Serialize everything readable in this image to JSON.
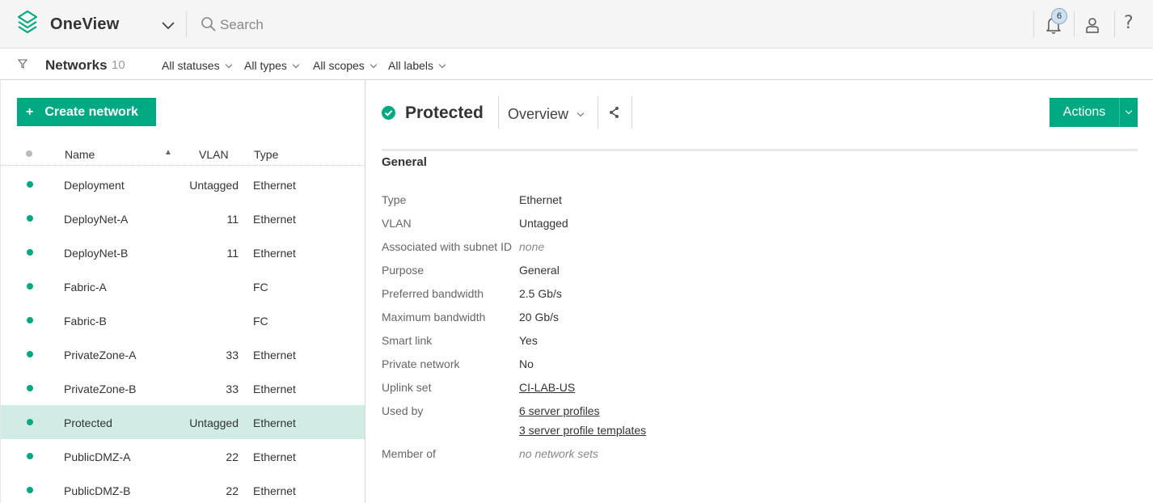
{
  "app": {
    "title": "OneView",
    "search_placeholder": "Search",
    "notification_count": "6",
    "accent_color": "#01a982",
    "icons": [
      "app-logo",
      "chevron-down-icon",
      "search-icon",
      "bell-icon",
      "user-icon",
      "help-icon"
    ]
  },
  "filterbar": {
    "resource": "Networks",
    "count": "10",
    "filters": [
      "All statuses",
      "All types",
      "All scopes",
      "All labels"
    ]
  },
  "list": {
    "create_label": "Create network",
    "columns": {
      "name": "Name",
      "vlan": "VLAN",
      "type": "Type"
    },
    "sort": "Name ascending",
    "rows": [
      {
        "name": "Deployment",
        "vlan": "Untagged",
        "type": "Ethernet",
        "status": "ok"
      },
      {
        "name": "DeployNet-A",
        "vlan": "11",
        "type": "Ethernet",
        "status": "ok"
      },
      {
        "name": "DeployNet-B",
        "vlan": "11",
        "type": "Ethernet",
        "status": "ok"
      },
      {
        "name": "Fabric-A",
        "vlan": "",
        "type": "FC",
        "status": "ok"
      },
      {
        "name": "Fabric-B",
        "vlan": "",
        "type": "FC",
        "status": "ok"
      },
      {
        "name": "PrivateZone-A",
        "vlan": "33",
        "type": "Ethernet",
        "status": "ok"
      },
      {
        "name": "PrivateZone-B",
        "vlan": "33",
        "type": "Ethernet",
        "status": "ok"
      },
      {
        "name": "Protected",
        "vlan": "Untagged",
        "type": "Ethernet",
        "status": "ok",
        "selected": true
      },
      {
        "name": "PublicDMZ-A",
        "vlan": "22",
        "type": "Ethernet",
        "status": "ok"
      },
      {
        "name": "PublicDMZ-B",
        "vlan": "22",
        "type": "Ethernet",
        "status": "ok"
      }
    ]
  },
  "detail": {
    "title": "Protected",
    "view": "Overview",
    "actions_label": "Actions",
    "section": "General",
    "properties": {
      "type_label": "Type",
      "type": "Ethernet",
      "vlan_label": "VLAN",
      "vlan": "Untagged",
      "subnet_label": "Associated with subnet ID",
      "subnet": "none",
      "purpose_label": "Purpose",
      "purpose": "General",
      "pref_bw_label": "Preferred bandwidth",
      "pref_bw": "2.5 Gb/s",
      "max_bw_label": "Maximum bandwidth",
      "max_bw": "20 Gb/s",
      "smart_link_label": "Smart link",
      "smart_link": "Yes",
      "private_label": "Private network",
      "private": "No",
      "uplink_label": "Uplink set",
      "uplink": "CI-LAB-US",
      "used_by_label": "Used by",
      "used_by_profiles": "6 server profiles",
      "used_by_templates": "3 server profile templates",
      "member_label": "Member of",
      "member": "no network sets"
    }
  }
}
